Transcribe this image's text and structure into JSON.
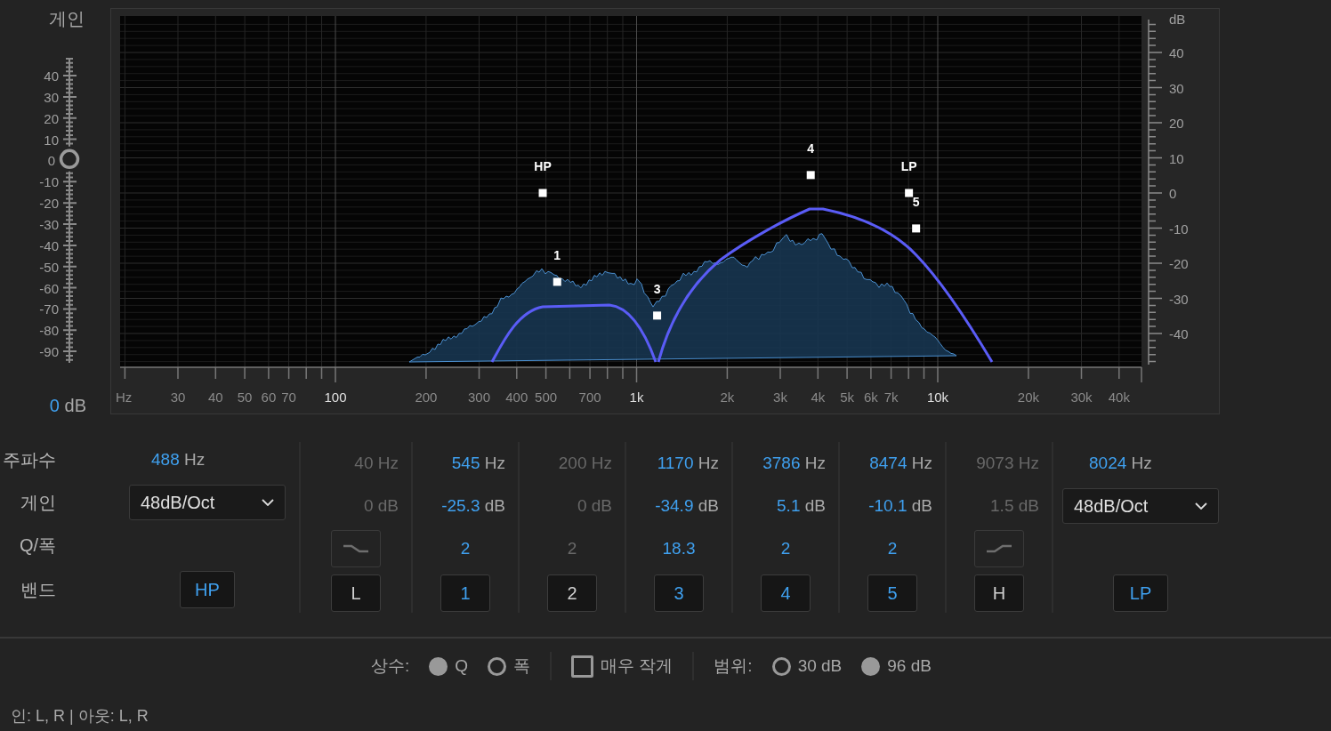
{
  "master_gain": {
    "label": "게인",
    "ticks": [
      "40",
      "30",
      "20",
      "10",
      "0",
      "-10",
      "-20",
      "-30",
      "-40",
      "-50",
      "-60",
      "-70",
      "-80",
      "-90"
    ],
    "level": 0.67,
    "value": "0",
    "unit": "dB"
  },
  "graph": {
    "db_unit": "dB",
    "db_labels": [
      "40",
      "30",
      "20",
      "10",
      "0",
      "-10",
      "-20",
      "-30",
      "-40"
    ],
    "freq_labels": [
      {
        "text": "Hz",
        "major": false
      },
      {
        "text": "30",
        "major": false
      },
      {
        "text": "40",
        "major": false
      },
      {
        "text": "50",
        "major": false
      },
      {
        "text": "60",
        "major": false
      },
      {
        "text": "70",
        "major": false
      },
      {
        "text": "100",
        "major": true
      },
      {
        "text": "200",
        "major": false
      },
      {
        "text": "300",
        "major": false
      },
      {
        "text": "400",
        "major": false
      },
      {
        "text": "500",
        "major": false
      },
      {
        "text": "700",
        "major": false
      },
      {
        "text": "1k",
        "major": true
      },
      {
        "text": "2k",
        "major": false
      },
      {
        "text": "3k",
        "major": false
      },
      {
        "text": "4k",
        "major": false
      },
      {
        "text": "5k",
        "major": false
      },
      {
        "text": "6k",
        "major": false
      },
      {
        "text": "7k",
        "major": false
      },
      {
        "text": "10k",
        "major": true
      },
      {
        "text": "20k",
        "major": false
      },
      {
        "text": "30k",
        "major": false
      },
      {
        "text": "40k",
        "major": false
      }
    ]
  },
  "row_labels": [
    "주파수",
    "게인",
    "Q/폭",
    "밴드"
  ],
  "bands": [
    {
      "kind": "high_pass",
      "enabled": true,
      "frequency": "488",
      "freq_unit": "Hz",
      "slope": "48dB/Oct",
      "button": "HP",
      "node_label": "HP"
    },
    {
      "kind": "low_shelf",
      "enabled": false,
      "frequency": "40",
      "freq_unit": "Hz",
      "gain": "0",
      "gain_unit": "dB",
      "button": "L"
    },
    {
      "kind": "peak",
      "enabled": true,
      "frequency": "545",
      "freq_unit": "Hz",
      "gain": "-25.3",
      "gain_unit": "dB",
      "q": "2",
      "button": "1",
      "node_label": "1"
    },
    {
      "kind": "peak",
      "enabled": false,
      "frequency": "200",
      "freq_unit": "Hz",
      "gain": "0",
      "gain_unit": "dB",
      "q": "2",
      "button": "2"
    },
    {
      "kind": "peak",
      "enabled": true,
      "frequency": "1170",
      "freq_unit": "Hz",
      "gain": "-34.9",
      "gain_unit": "dB",
      "q": "18.3",
      "button": "3",
      "node_label": "3"
    },
    {
      "kind": "peak",
      "enabled": true,
      "frequency": "3786",
      "freq_unit": "Hz",
      "gain": "5.1",
      "gain_unit": "dB",
      "q": "2",
      "button": "4",
      "node_label": "4"
    },
    {
      "kind": "peak",
      "enabled": true,
      "frequency": "8474",
      "freq_unit": "Hz",
      "gain": "-10.1",
      "gain_unit": "dB",
      "q": "2",
      "button": "5",
      "node_label": "5"
    },
    {
      "kind": "high_shelf",
      "enabled": false,
      "frequency": "9073",
      "freq_unit": "Hz",
      "gain": "1.5",
      "gain_unit": "dB",
      "button": "H"
    },
    {
      "kind": "low_pass",
      "enabled": true,
      "frequency": "8024",
      "freq_unit": "Hz",
      "slope": "48dB/Oct",
      "button": "LP",
      "node_label": "LP"
    }
  ],
  "options": {
    "constant": {
      "label": "상수:",
      "choices": [
        {
          "label": "Q",
          "selected": true
        },
        {
          "label": "폭",
          "selected": false
        }
      ]
    },
    "ultra_quiet": {
      "label": "매우 작게",
      "checked": false
    },
    "range": {
      "label": "범위:",
      "choices": [
        {
          "label": "30 dB",
          "selected": false
        },
        {
          "label": "96 dB",
          "selected": true
        }
      ]
    }
  },
  "status": "인: L, R | 아웃: L, R"
}
